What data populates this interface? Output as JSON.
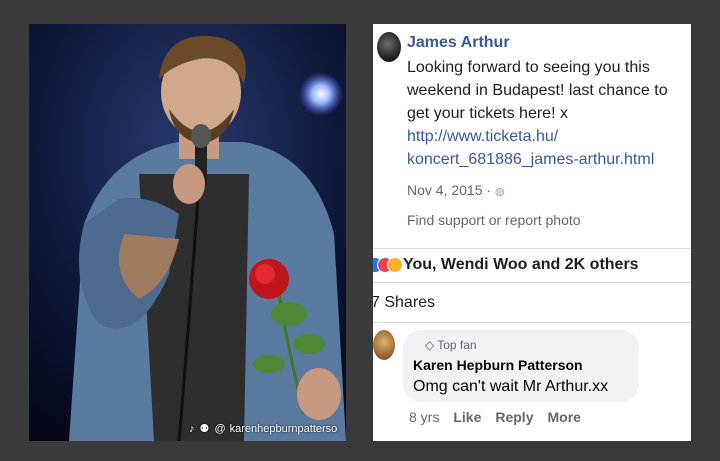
{
  "photo": {
    "watermark_icons": "♪ ⚉ @",
    "watermark_handle": "karenhepburnpatterso"
  },
  "post": {
    "author": "James Arthur",
    "text_lines": [
      "Looking forward to seeing you this",
      "weekend in Budapest! last chance to",
      "get your tickets here! x"
    ],
    "link_lines": [
      "http://www.ticketa.hu/",
      "koncert_681886_james-arthur.html"
    ],
    "date": "Nov 4, 2015 ·",
    "report_link": "Find support or report photo"
  },
  "reactions": {
    "summary": "You, Wendi Woo and 2K others",
    "shares": "7 Shares"
  },
  "comment": {
    "badge": "Top fan",
    "author": "Karen Hepburn Patterson",
    "text": "Omg can't wait Mr Arthur.xx",
    "time": "8 yrs",
    "like": "Like",
    "reply": "Reply",
    "more": "More"
  },
  "colors": {
    "background": "#3a3a3a",
    "link": "#385898",
    "bubble": "#f0f2f5"
  }
}
